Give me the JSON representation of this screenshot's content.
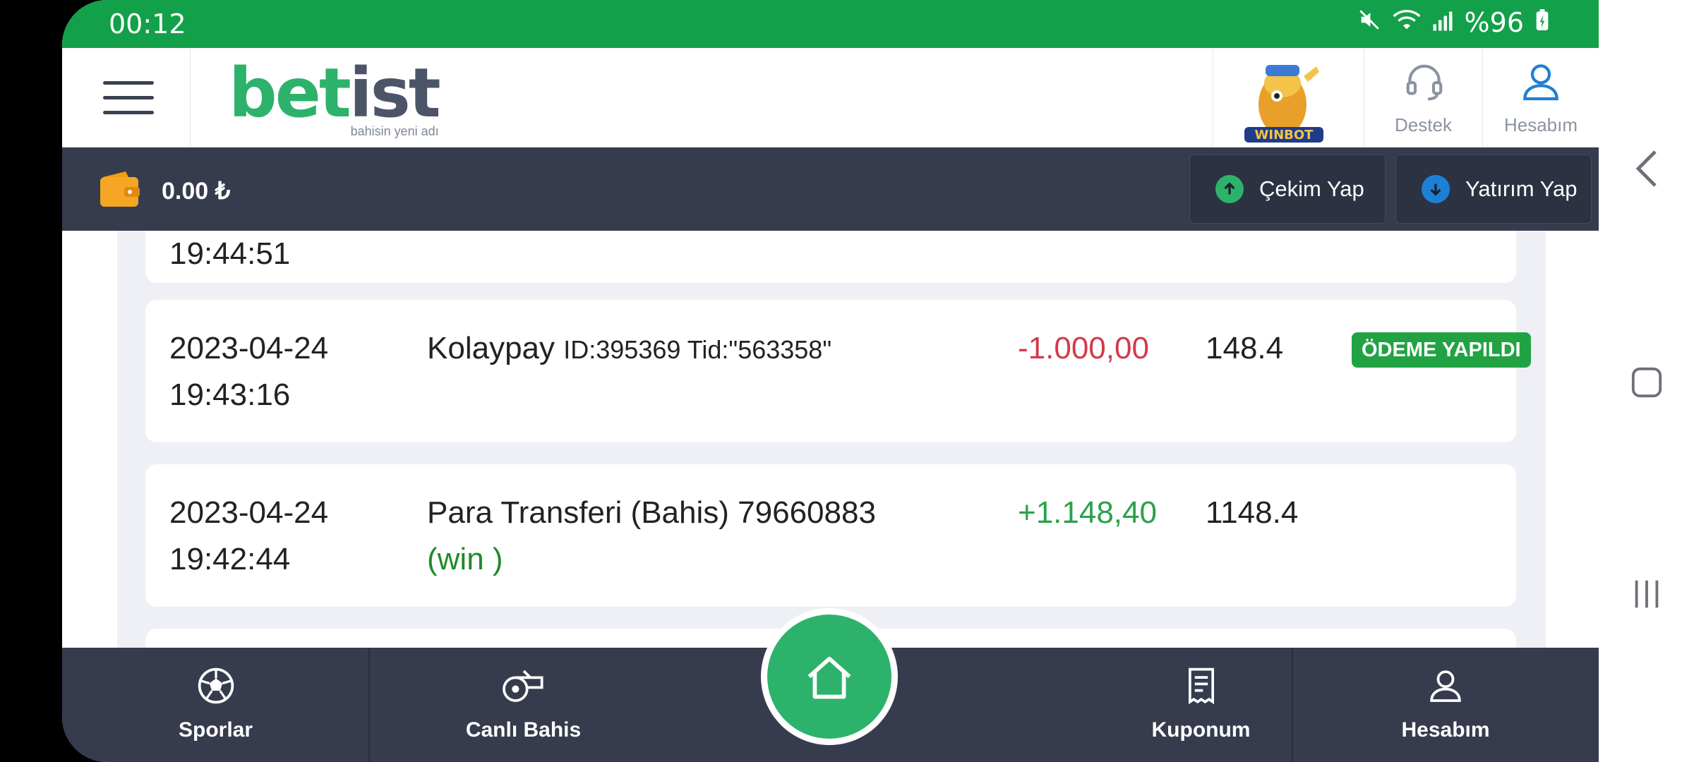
{
  "status_bar": {
    "time": "00:12",
    "battery": "%96"
  },
  "header": {
    "logo_text_green": "bet",
    "logo_text_dark": "ist",
    "logo_tagline": "bahisin yeni adı",
    "mascot_text": "WINBOT",
    "support_label": "Destek",
    "account_label": "Hesabım"
  },
  "wallet": {
    "balance": "0.00 ₺",
    "withdraw_label": "Çekim Yap",
    "deposit_label": "Yatırım Yap"
  },
  "transactions": [
    {
      "date": "",
      "time": "19:44:51",
      "description": "",
      "description_detail": "",
      "amount": "",
      "balance": "",
      "status": ""
    },
    {
      "date": "2023-04-24",
      "time": "19:43:16",
      "description": "Kolaypay",
      "description_detail": "ID:395369 Tid:\"563358\"",
      "amount": "-1.000,00",
      "balance": "148.4",
      "status": "ÖDEME YAPILDI"
    },
    {
      "date": "2023-04-24",
      "time": "19:42:44",
      "description": "Para Transferi (Bahis) 79660883",
      "description_detail": "(win )",
      "amount": "+1.148,40",
      "balance": "1148.4",
      "status": ""
    }
  ],
  "bottom_nav": {
    "sports": "Sporlar",
    "live": "Canlı Bahis",
    "coupon": "Kuponum",
    "account": "Hesabım"
  },
  "colors": {
    "brand_green": "#13a04a",
    "dark_bar": "#363c4d",
    "negative": "#d33a4a",
    "positive": "#2aa14a"
  }
}
